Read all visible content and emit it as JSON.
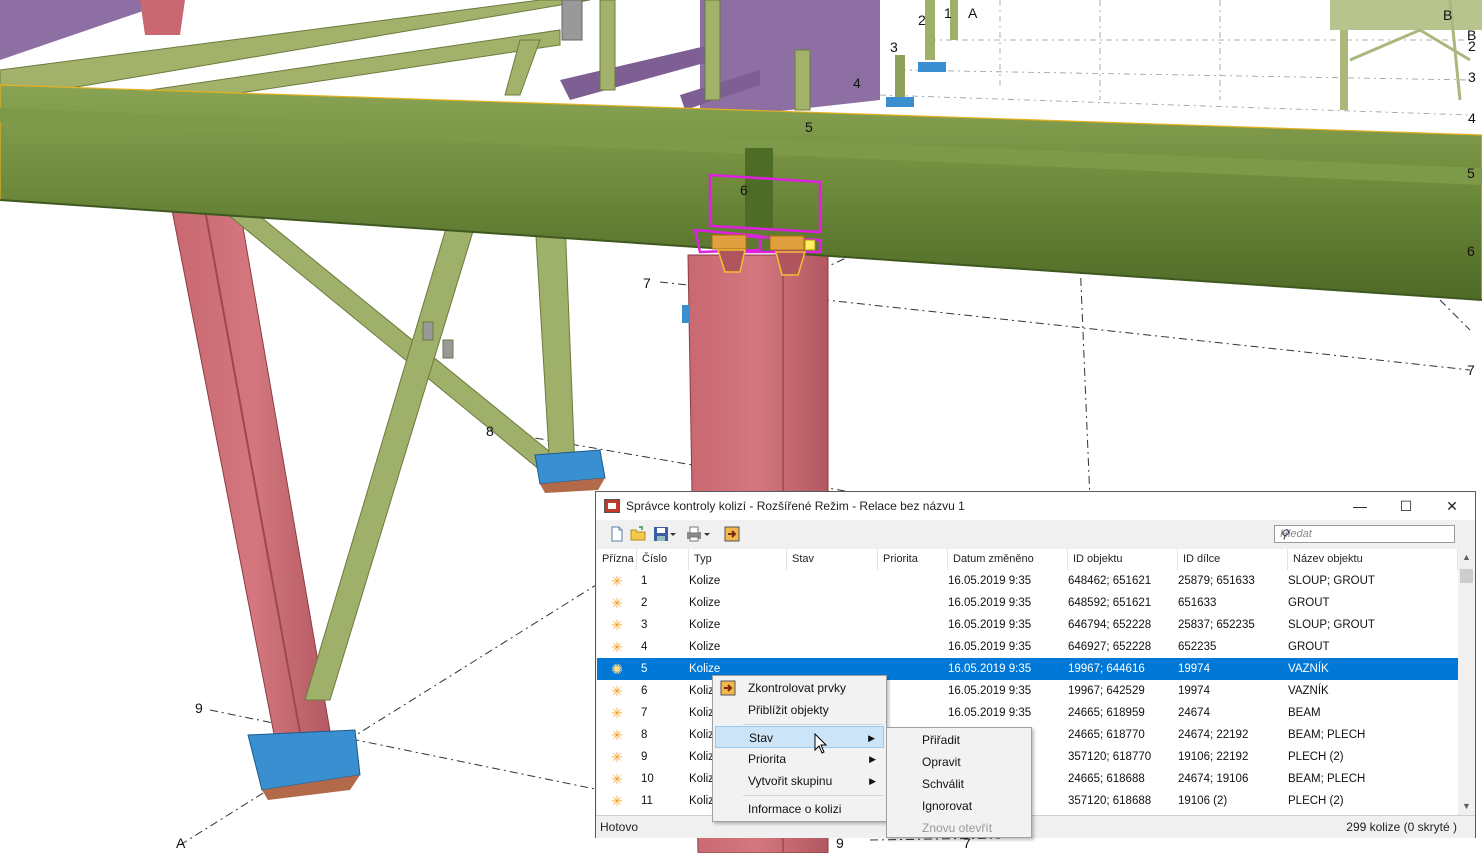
{
  "viewport": {
    "grid_labels": [
      "1",
      "2",
      "3",
      "4",
      "5",
      "6",
      "7",
      "8",
      "9",
      "A",
      "B",
      "A",
      "B",
      "2",
      "3",
      "4",
      "5",
      "6",
      "7",
      "9",
      "7"
    ]
  },
  "dialog": {
    "title": "Správce kontroly kolizí - Rozšířené Režim - Relace bez názvu 1",
    "window_buttons": {
      "minimize": "—",
      "maximize": "☐",
      "close": "✕"
    },
    "search_placeholder": "Hledat",
    "columns": [
      "Přízna",
      "Číslo",
      "Typ",
      "Stav",
      "Priorita",
      "Datum změněno",
      "ID objektu",
      "ID dílce",
      "Název objektu"
    ],
    "rows": [
      {
        "num": "1",
        "type": "Kolize",
        "status": "",
        "priority": "",
        "date": "16.05.2019 9:35",
        "obj_id": "648462; 651621",
        "part_id": "25879; 651633",
        "name": "SLOUP; GROUT"
      },
      {
        "num": "2",
        "type": "Kolize",
        "status": "",
        "priority": "",
        "date": "16.05.2019 9:35",
        "obj_id": "648592; 651621",
        "part_id": "651633",
        "name": "GROUT"
      },
      {
        "num": "3",
        "type": "Kolize",
        "status": "",
        "priority": "",
        "date": "16.05.2019 9:35",
        "obj_id": "646794; 652228",
        "part_id": "25837; 652235",
        "name": "SLOUP; GROUT"
      },
      {
        "num": "4",
        "type": "Kolize",
        "status": "",
        "priority": "",
        "date": "16.05.2019 9:35",
        "obj_id": "646927; 652228",
        "part_id": "652235",
        "name": "GROUT"
      },
      {
        "num": "5",
        "type": "Kolize",
        "status": "",
        "priority": "",
        "date": "16.05.2019 9:35",
        "obj_id": "19967; 644616",
        "part_id": "19974",
        "name": "VAZNÍK",
        "selected": true
      },
      {
        "num": "6",
        "type": "Kolize",
        "status": "",
        "priority": "",
        "date": "16.05.2019 9:35",
        "obj_id": "19967; 642529",
        "part_id": "19974",
        "name": "VAZNÍK"
      },
      {
        "num": "7",
        "type": "Kolize",
        "status": "",
        "priority": "",
        "date": "16.05.2019 9:35",
        "obj_id": "24665; 618959",
        "part_id": "24674",
        "name": "BEAM"
      },
      {
        "num": "8",
        "type": "Kolize",
        "status": "",
        "priority": "",
        "date": "",
        "obj_id": "24665; 618770",
        "part_id": "24674; 22192",
        "name": "BEAM; PLECH"
      },
      {
        "num": "9",
        "type": "Kolize",
        "status": "",
        "priority": "",
        "date": "",
        "obj_id": "357120; 618770",
        "part_id": "19106; 22192",
        "name": "PLECH (2)"
      },
      {
        "num": "10",
        "type": "Kolize",
        "status": "",
        "priority": "",
        "date": "",
        "obj_id": "24665; 618688",
        "part_id": "24674; 19106",
        "name": "BEAM; PLECH"
      },
      {
        "num": "11",
        "type": "Kolize",
        "status": "",
        "priority": "",
        "date": "",
        "obj_id": "357120; 618688",
        "part_id": "19106 (2)",
        "name": "PLECH (2)"
      }
    ],
    "status_left": "Hotovo",
    "status_right": "299 kolize (0 skryté )"
  },
  "context_menu": {
    "items": [
      {
        "label": "Zkontrolovat prvky"
      },
      {
        "label": "Přiblížit objekty"
      },
      {
        "label": "Stav",
        "submenu": true
      },
      {
        "label": "Priorita",
        "submenu": true
      },
      {
        "label": "Vytvořit skupinu",
        "submenu": true
      },
      {
        "label": "Informace o kolizi"
      }
    ]
  },
  "submenu": {
    "items": [
      {
        "label": "Přiřadit"
      },
      {
        "label": "Opravit"
      },
      {
        "label": "Schválit"
      },
      {
        "label": "Ignorovat"
      },
      {
        "label": "Znovu otevřít",
        "disabled": true
      }
    ]
  },
  "colors": {
    "selection": "#0078d7",
    "beam_green": "#6f8b3c",
    "column_red": "#c85a64",
    "truss_purple": "#8d6fa3",
    "highlight_magenta": "#e020e0"
  }
}
